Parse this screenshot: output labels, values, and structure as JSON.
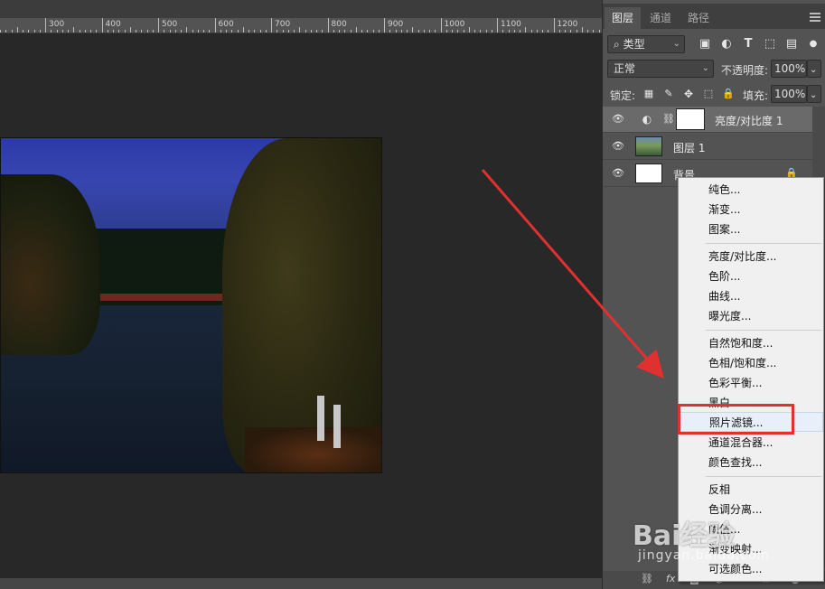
{
  "ruler": {
    "labels": [
      "300",
      "400",
      "500",
      "600",
      "700",
      "800",
      "900",
      "1000",
      "1100",
      "1200"
    ]
  },
  "panel": {
    "tabs": [
      "图层",
      "通道",
      "路径"
    ],
    "filter_kind": "类型",
    "blend_mode": "正常",
    "opacity_label": "不透明度:",
    "opacity_value": "100%",
    "lock_label": "锁定:",
    "fill_label": "填充:",
    "fill_value": "100%",
    "layers": [
      {
        "name": "亮度/对比度 1",
        "selected": true
      },
      {
        "name": "图层 1",
        "selected": false
      },
      {
        "name": "背景",
        "selected": false
      }
    ],
    "bottom_icons": [
      "link-icon",
      "fx-icon"
    ],
    "bottom_fx": "fx"
  },
  "menu": {
    "items": [
      "纯色...",
      "渐变...",
      "图案...",
      "亮度/对比度...",
      "色阶...",
      "曲线...",
      "曝光度...",
      "自然饱和度...",
      "色相/饱和度...",
      "色彩平衡...",
      "黑白...",
      "照片滤镜...",
      "通道混合器...",
      "颜色查找...",
      "反相",
      "色调分离...",
      "阈值...",
      "渐变映射...",
      "可选颜色..."
    ],
    "highlighted": "照片滤镜..."
  },
  "watermark": {
    "text": "Bai经验",
    "sub": "jingyan.baidu.com"
  },
  "colors": {
    "annotation_red": "#e03030",
    "panel_bg": "#535353",
    "menu_bg": "#f0f0f0"
  }
}
